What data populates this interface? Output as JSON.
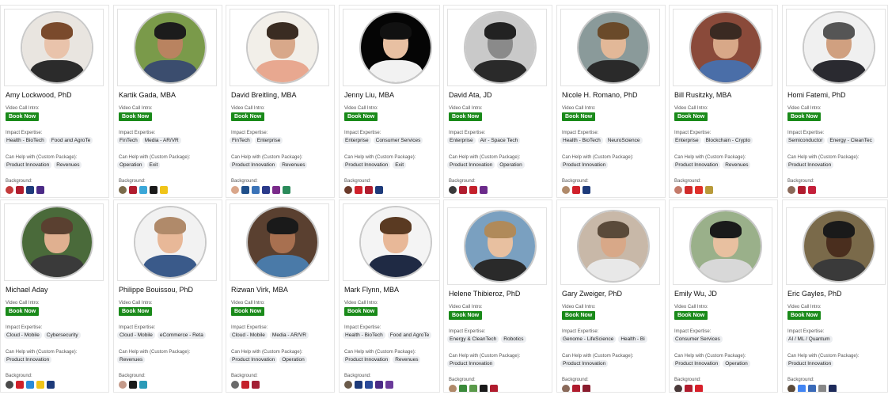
{
  "ui": {
    "video_label": "Video Call Intro:",
    "book_label": "Book Now",
    "impact_label": "Impact Expertise:",
    "help_label": "Can Help with (Custom Package):",
    "background_label": "Background:"
  },
  "cards": [
    {
      "name": "Amy Lockwood, PhD",
      "impact": [
        "Health - BioTech",
        "Food and AgroTe"
      ],
      "help": [
        "Product Innovation",
        "Revenues"
      ],
      "logos": [
        "#c43b3b",
        "#b01c2e",
        "#1d3a7a",
        "#4b2a86"
      ],
      "photo": {
        "bg": "#e9e5e0",
        "skin": "#e9c3ab",
        "hair": "#7a4a2c",
        "shirt": "#2b2b2b"
      }
    },
    {
      "name": "Kartik Gada, MBA",
      "impact": [
        "FinTech",
        "Media - AR/VR"
      ],
      "help": [
        "Operation",
        "Exit"
      ],
      "logos": [
        "#7b6b4b",
        "#b01c2e",
        "#3aa7d8",
        "#1a1a1a",
        "#f0c419"
      ],
      "photo": {
        "bg": "#7a9a4a",
        "skin": "#b98360",
        "hair": "#1c1c1c",
        "shirt": "#3b4d6e"
      }
    },
    {
      "name": "David Breitling, MBA",
      "impact": [
        "FinTech",
        "Enterprise"
      ],
      "help": [
        "Product Innovation",
        "Revenues"
      ],
      "logos": [
        "#d9a68a",
        "#1f4f8a",
        "#3a73b8",
        "#2a3a8a",
        "#7a2a8a",
        "#2a8a5a"
      ],
      "photo": {
        "bg": "#f2efe9",
        "skin": "#d8a88a",
        "hair": "#3a2c22",
        "shirt": "#e8a890"
      }
    },
    {
      "name": "Jenny Liu, MBA",
      "impact": [
        "Enterprise",
        "Consumer Services"
      ],
      "help": [
        "Product Innovation",
        "Exit"
      ],
      "logos": [
        "#6b3a2a",
        "#d0202a",
        "#b01c2e",
        "#1d3a7a"
      ],
      "photo": {
        "bg": "#050505",
        "skin": "#e8c0a2",
        "hair": "#111111",
        "shirt": "#f2f2f2"
      }
    },
    {
      "name": "David Ata, JD",
      "impact": [
        "Enterprise",
        "Air - Space Tech"
      ],
      "help": [
        "Product Innovation",
        "Operation"
      ],
      "logos": [
        "#3a3a3a",
        "#b01c2e",
        "#c4202a",
        "#6b2a8a"
      ],
      "photo": {
        "bg": "#c9c9c9",
        "skin": "#8a8a8a",
        "hair": "#222222",
        "shirt": "#2a2a2a"
      }
    },
    {
      "name": "Nicole H. Romano, PhD",
      "impact": [
        "Health - BioTech",
        "NeuroScience"
      ],
      "help": [
        "Product Innovation"
      ],
      "logos": [
        "#b08a6a",
        "#d0202a",
        "#1d3a7a"
      ],
      "photo": {
        "bg": "#8a9a9a",
        "skin": "#e2b898",
        "hair": "#6a4a2a",
        "shirt": "#2a2a2a"
      }
    },
    {
      "name": "Bill Rusitzky, MBA",
      "impact": [
        "Enterprise",
        "Blockchain - Crypto"
      ],
      "help": [
        "Product Innovation",
        "Revenues"
      ],
      "logos": [
        "#c47a6a",
        "#d02a2a",
        "#e0302a",
        "#b89a3a"
      ],
      "photo": {
        "bg": "#8a4a3a",
        "skin": "#d8a888",
        "hair": "#3a2a22",
        "shirt": "#4a6ea8"
      }
    },
    {
      "name": "Homi Fatemi, PhD",
      "impact": [
        "Semiconductor",
        "Energy - CleanTec"
      ],
      "help": [
        "Product Innovation"
      ],
      "logos": [
        "#8a6a5a",
        "#b01c2e",
        "#c4203a"
      ],
      "photo": {
        "bg": "#f0f0f0",
        "skin": "#d0a080",
        "hair": "#555555",
        "shirt": "#2a2a30"
      }
    },
    {
      "name": "Michael Aday",
      "impact": [
        "Cloud - Mobile",
        "Cybersecurity"
      ],
      "help": [
        "Product Innovation"
      ],
      "logos": [
        "#4a4a4a",
        "#d0202a",
        "#2a8ad8",
        "#f0c419",
        "#1d3a7a"
      ],
      "photo": {
        "bg": "#4a6a3a",
        "skin": "#e0b090",
        "hair": "#5a4030",
        "shirt": "#3a3a3a"
      }
    },
    {
      "name": "Philippe Bouissou, PhD",
      "impact": [
        "Cloud - Mobile",
        "eCommerce - Reta"
      ],
      "help": [
        "Revenues"
      ],
      "logos": [
        "#c49a8a",
        "#1a1a1a",
        "#2a9ab8"
      ],
      "photo": {
        "bg": "#f2f2f2",
        "skin": "#e8b898",
        "hair": "#b08a6a",
        "shirt": "#3a5a8a"
      }
    },
    {
      "name": "Rizwan Virk, MBA",
      "impact": [
        "Cloud - Mobile",
        "Media - AR/VR"
      ],
      "help": [
        "Product Innovation",
        "Operation"
      ],
      "logos": [
        "#6a6a6a",
        "#c4202a",
        "#a31f34"
      ],
      "photo": {
        "bg": "#5a4030",
        "skin": "#a87050",
        "hair": "#1a1a1a",
        "shirt": "#4a7aa8"
      }
    },
    {
      "name": "Mark Flynn, MBA",
      "impact": [
        "Health - BioTech",
        "Food and AgroTe"
      ],
      "help": [
        "Product Innovation",
        "Revenues"
      ],
      "logos": [
        "#6a5a4a",
        "#1d3a7a",
        "#2a4a9a",
        "#4b2a86",
        "#6a3a9a"
      ],
      "photo": {
        "bg": "#f4f4f4",
        "skin": "#e8b898",
        "hair": "#5a3a22",
        "shirt": "#1f2a44"
      }
    },
    {
      "name": "Helene Thibieroz, PhD",
      "impact": [
        "Energy & CleanTech",
        "Robotics"
      ],
      "help": [
        "Product Innovation"
      ],
      "logos": [
        "#b08a6a",
        "#3a8a3a",
        "#5a9a4a",
        "#1a1a1a",
        "#b01c2e"
      ],
      "photo": {
        "bg": "#7aa0c0",
        "skin": "#e8c0a0",
        "hair": "#b08a5a",
        "shirt": "#2a2a2a"
      }
    },
    {
      "name": "Gary Zweiger, PhD",
      "impact": [
        "Genome - LifeScience",
        "Health - Bi"
      ],
      "help": [
        "Product Innovation"
      ],
      "logos": [
        "#8a6a5a",
        "#b01c2e",
        "#8a1c2e"
      ],
      "photo": {
        "bg": "#c8b8a8",
        "skin": "#d8a888",
        "hair": "#5a4a3a",
        "shirt": "#e8e8e8"
      }
    },
    {
      "name": "Emily Wu, JD",
      "impact": [
        "Consumer Services"
      ],
      "help": [
        "Product Innovation",
        "Operation"
      ],
      "logos": [
        "#4a3a3a",
        "#b01c2e",
        "#d8202a"
      ],
      "photo": {
        "bg": "#9ab08a",
        "skin": "#e8c0a0",
        "hair": "#1a1a1a",
        "shirt": "#d8d8d8"
      }
    },
    {
      "name": "Eric Gayles, PhD",
      "impact": [
        "AI / ML / Quantum"
      ],
      "help": [
        "Product Innovation"
      ],
      "logos": [
        "#5a4a3a",
        "#4285f4",
        "#3a6ab8",
        "#888888",
        "#1d2a5a"
      ],
      "photo": {
        "bg": "#7a6a4a",
        "skin": "#4a2e1e",
        "hair": "#1a1a1a",
        "shirt": "#3a3a3a"
      }
    }
  ]
}
